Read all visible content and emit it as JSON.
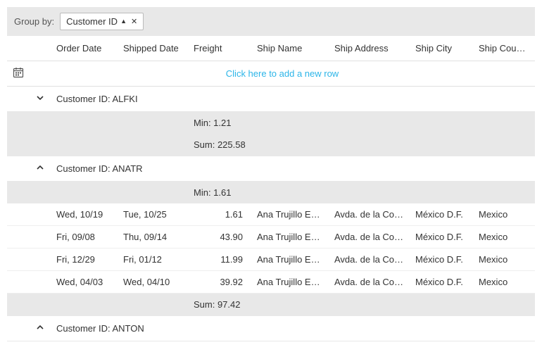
{
  "groupBar": {
    "label": "Group by:",
    "chip": {
      "field": "Customer ID",
      "sortAsc": true
    }
  },
  "columns": {
    "orderDate": "Order Date",
    "shippedDate": "Shipped Date",
    "freight": "Freight",
    "shipName": "Ship Name",
    "shipAddress": "Ship Address",
    "shipCity": "Ship City",
    "shipCountry": "Ship Country"
  },
  "newRow": {
    "link": "Click here to add a new row"
  },
  "groups": [
    {
      "expanded": false,
      "header": "Customer ID: ALFKI",
      "summaries": [
        {
          "label": "Min: 1.21"
        },
        {
          "label": "Sum: 225.58"
        }
      ]
    },
    {
      "expanded": true,
      "header": "Customer ID: ANATR",
      "topSummaries": [
        {
          "label": "Min: 1.61"
        }
      ],
      "rows": [
        {
          "orderDate": "Wed, 10/19",
          "shippedDate": "Tue, 10/25",
          "freight": "1.61",
          "shipName": "Ana Trujillo Emp…",
          "shipAddress": "Avda. de la Cons…",
          "shipCity": "México D.F.",
          "shipCountry": "Mexico"
        },
        {
          "orderDate": "Fri, 09/08",
          "shippedDate": "Thu, 09/14",
          "freight": "43.90",
          "shipName": "Ana Trujillo Emp…",
          "shipAddress": "Avda. de la Cons…",
          "shipCity": "México D.F.",
          "shipCountry": "Mexico"
        },
        {
          "orderDate": "Fri, 12/29",
          "shippedDate": "Fri, 01/12",
          "freight": "11.99",
          "shipName": "Ana Trujillo Emp…",
          "shipAddress": "Avda. de la Cons…",
          "shipCity": "México D.F.",
          "shipCountry": "Mexico"
        },
        {
          "orderDate": "Wed, 04/03",
          "shippedDate": "Wed, 04/10",
          "freight": "39.92",
          "shipName": "Ana Trujillo Emp…",
          "shipAddress": "Avda. de la Cons…",
          "shipCity": "México D.F.",
          "shipCountry": "Mexico"
        }
      ],
      "bottomSummaries": [
        {
          "label": "Sum: 97.42"
        }
      ]
    },
    {
      "expanded": true,
      "header": "Customer ID: ANTON"
    }
  ]
}
